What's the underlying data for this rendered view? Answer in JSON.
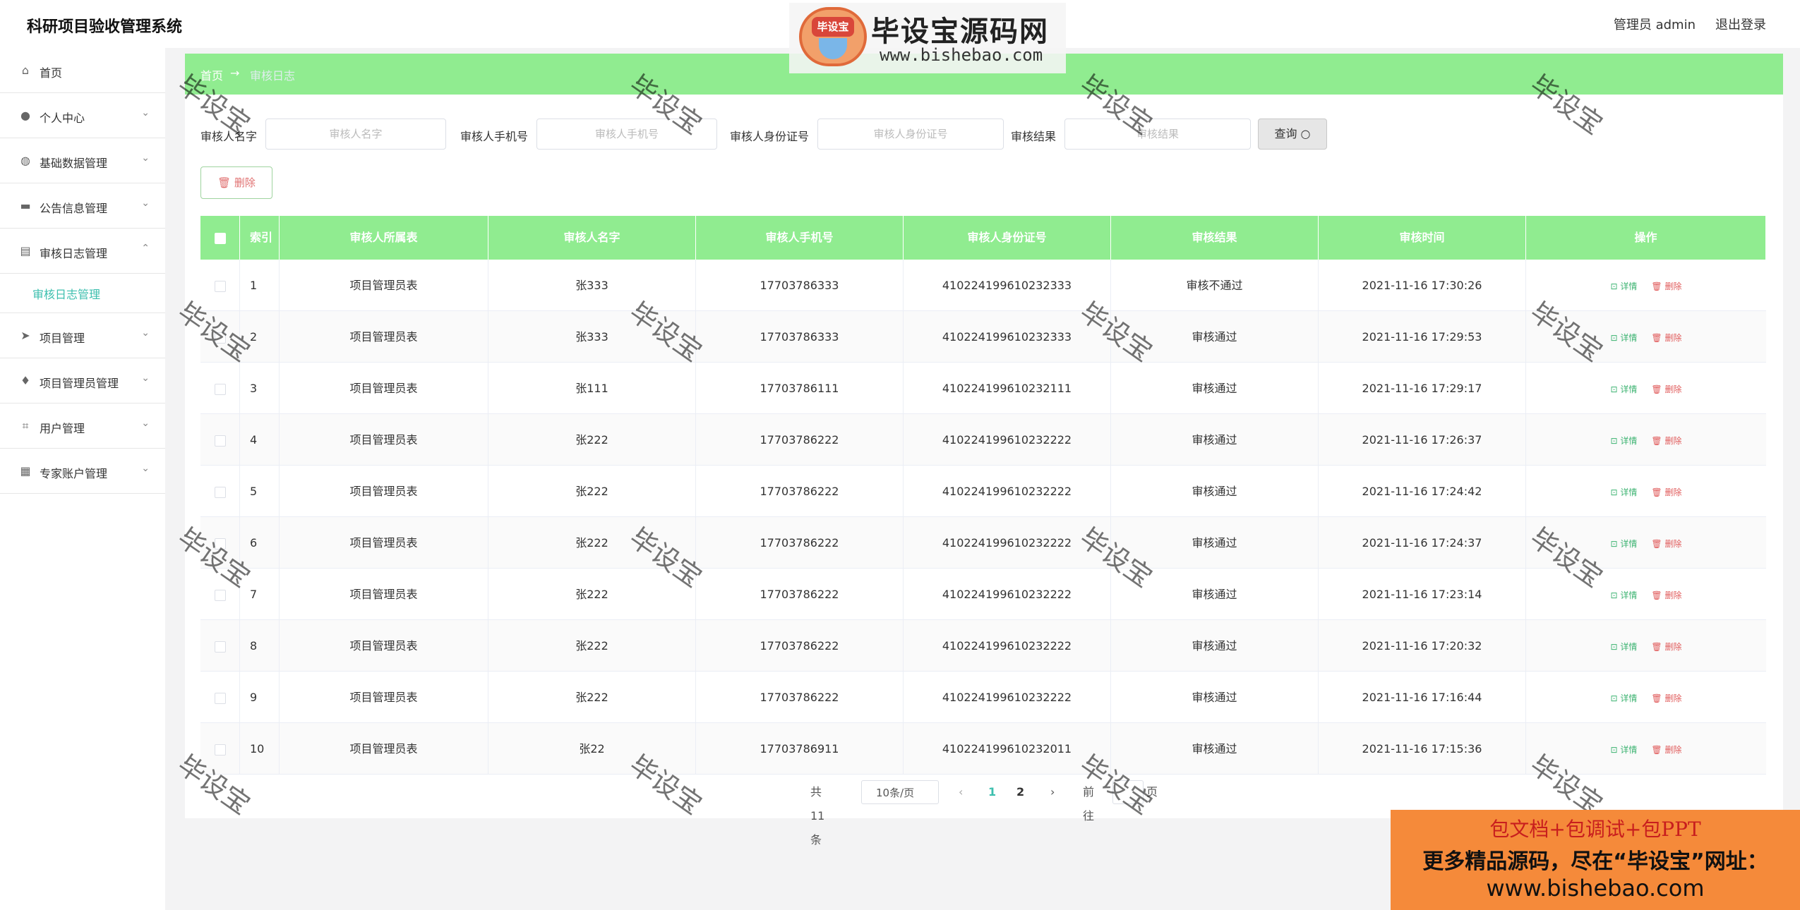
{
  "app": {
    "title": "科研项目验收管理系统"
  },
  "user": {
    "greeting": "管理员 admin",
    "logout": "退出登录"
  },
  "brand": {
    "badge": "毕设宝",
    "name": "毕设宝源码网",
    "url": "www.bishebao.com"
  },
  "sidebar": {
    "items": [
      {
        "label": "首页",
        "icon": "home-icon",
        "glyph": "⌂",
        "chevron": ""
      },
      {
        "label": "个人中心",
        "icon": "user-icon",
        "glyph": "●",
        "chevron": "⌄"
      },
      {
        "label": "基础数据管理",
        "icon": "dashboard-icon",
        "glyph": "◍",
        "chevron": "⌄"
      },
      {
        "label": "公告信息管理",
        "icon": "monitor-icon",
        "glyph": "▬",
        "chevron": "⌄"
      },
      {
        "label": "审核日志管理",
        "icon": "clipboard-icon",
        "glyph": "▤",
        "chevron": "⌃"
      }
    ],
    "sub_active": "审核日志管理",
    "items2": [
      {
        "label": "项目管理",
        "icon": "send-icon",
        "glyph": "➤",
        "chevron": "⌄"
      },
      {
        "label": "项目管理员管理",
        "icon": "microphone-icon",
        "glyph": "♦",
        "chevron": "⌄"
      },
      {
        "label": "用户管理",
        "icon": "crop-icon",
        "glyph": "⌗",
        "chevron": "⌄"
      },
      {
        "label": "专家账户管理",
        "icon": "stamp-icon",
        "glyph": "▦",
        "chevron": "⌄"
      }
    ]
  },
  "breadcrumb": {
    "home": "首页",
    "arrow": "→",
    "current": "审核日志"
  },
  "search": {
    "name_label": "审核人名字",
    "name_placeholder": "审核人名字",
    "phone_label": "审核人手机号",
    "phone_placeholder": "审核人手机号",
    "id_label": "审核人身份证号",
    "id_placeholder": "审核人身份证号",
    "result_label": "审核结果",
    "result_placeholder": "审核结果",
    "query_button": "查询 ○"
  },
  "toolbar": {
    "delete_label": "🗑 删除"
  },
  "table": {
    "headers": [
      "索引",
      "审核人所属表",
      "审核人名字",
      "审核人手机号",
      "审核人身份证号",
      "审核结果",
      "审核时间",
      "操作"
    ],
    "view_label": "⊡ 详情",
    "delete_label": "🗑 删除",
    "rows": [
      [
        "1",
        "项目管理员表",
        "张333",
        "17703786333",
        "410224199610232333",
        "审核不通过",
        "2021-11-16 17:30:26"
      ],
      [
        "2",
        "项目管理员表",
        "张333",
        "17703786333",
        "410224199610232333",
        "审核通过",
        "2021-11-16 17:29:53"
      ],
      [
        "3",
        "项目管理员表",
        "张111",
        "17703786111",
        "410224199610232111",
        "审核通过",
        "2021-11-16 17:29:17"
      ],
      [
        "4",
        "项目管理员表",
        "张222",
        "17703786222",
        "410224199610232222",
        "审核通过",
        "2021-11-16 17:26:37"
      ],
      [
        "5",
        "项目管理员表",
        "张222",
        "17703786222",
        "410224199610232222",
        "审核通过",
        "2021-11-16 17:24:42"
      ],
      [
        "6",
        "项目管理员表",
        "张222",
        "17703786222",
        "410224199610232222",
        "审核通过",
        "2021-11-16 17:24:37"
      ],
      [
        "7",
        "项目管理员表",
        "张222",
        "17703786222",
        "410224199610232222",
        "审核通过",
        "2021-11-16 17:23:14"
      ],
      [
        "8",
        "项目管理员表",
        "张222",
        "17703786222",
        "410224199610232222",
        "审核通过",
        "2021-11-16 17:20:32"
      ],
      [
        "9",
        "项目管理员表",
        "张222",
        "17703786222",
        "410224199610232222",
        "审核通过",
        "2021-11-16 17:16:44"
      ],
      [
        "10",
        "项目管理员表",
        "张22",
        "17703786911",
        "410224199610232011",
        "审核通过",
        "2021-11-16 17:15:36"
      ]
    ]
  },
  "pager": {
    "total": "共 11 条",
    "page_size": "10条/页",
    "prev": "‹",
    "page1": "1",
    "page2": "2",
    "next": "›",
    "goto": "前往",
    "goto_value": "1",
    "page_unit": "页"
  },
  "watermark": "毕设宝",
  "ad": {
    "line1": "包文档+包调试+包PPT",
    "line2": "更多精品源码，尽在“毕设宝”网址：",
    "line3": "www.bishebao.com"
  },
  "colors": {
    "accent": "#90ec90",
    "active": "#3cbfae",
    "ad_bg": "#f58a3a"
  }
}
